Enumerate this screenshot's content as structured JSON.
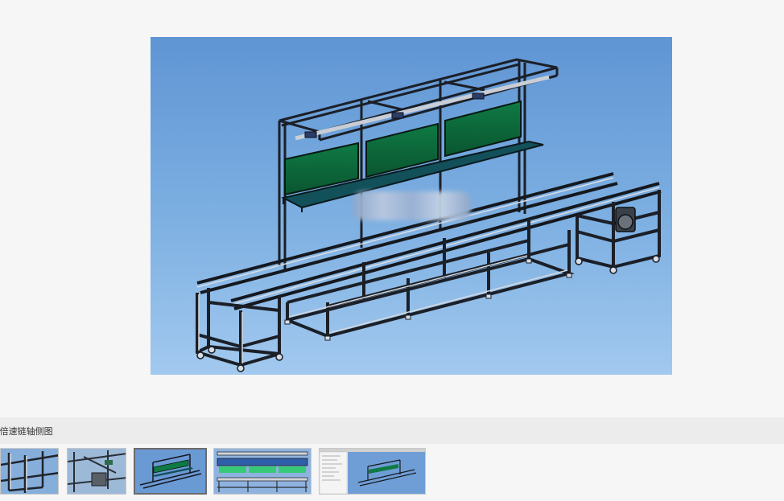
{
  "main_view": {
    "image_name": "assembly-line-3d-model",
    "blurred_label_present": true
  },
  "caption": {
    "text": ")倍速链轴侧图"
  },
  "thumbnails": [
    {
      "name": "thumb-frame-closeup-1",
      "active": false
    },
    {
      "name": "thumb-frame-closeup-2",
      "active": false
    },
    {
      "name": "thumb-isometric-view",
      "active": true
    },
    {
      "name": "thumb-front-view-green",
      "active": false
    },
    {
      "name": "thumb-cad-software-view",
      "active": false
    }
  ],
  "colors": {
    "page_bg": "#f6f6f6",
    "sky_top": "#5f95d4",
    "sky_bottom": "#a2c9ef",
    "frame_dark": "#1b1f27",
    "frame_light": "#cdd3db",
    "panel_green": "#0e6a3a",
    "shelf_teal": "#12505a",
    "caption_bg": "#ececec",
    "active_border": "#6b6b6b"
  }
}
